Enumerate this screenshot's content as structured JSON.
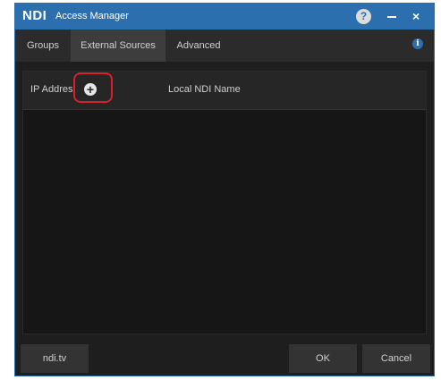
{
  "window": {
    "logo": "NDI",
    "title": "Access Manager",
    "help_glyph": "?",
    "close_glyph": "×"
  },
  "tabs": [
    {
      "label": "Groups"
    },
    {
      "label": "External Sources",
      "selected": true
    },
    {
      "label": "Advanced"
    }
  ],
  "info_glyph": "i",
  "list": {
    "columns": [
      "IP Addres",
      "Local NDI Name"
    ],
    "add_glyph": "+"
  },
  "footer": {
    "link_label": "ndi.tv",
    "ok_label": "OK",
    "cancel_label": "Cancel"
  },
  "colors": {
    "titlebar": "#2c6fae",
    "background": "#1e1e1e",
    "highlight": "#d8202a"
  },
  "icons": {
    "help": "help-icon",
    "minimize": "minimize-icon",
    "close": "close-icon",
    "info": "info-icon",
    "add": "plus-circle-icon"
  }
}
